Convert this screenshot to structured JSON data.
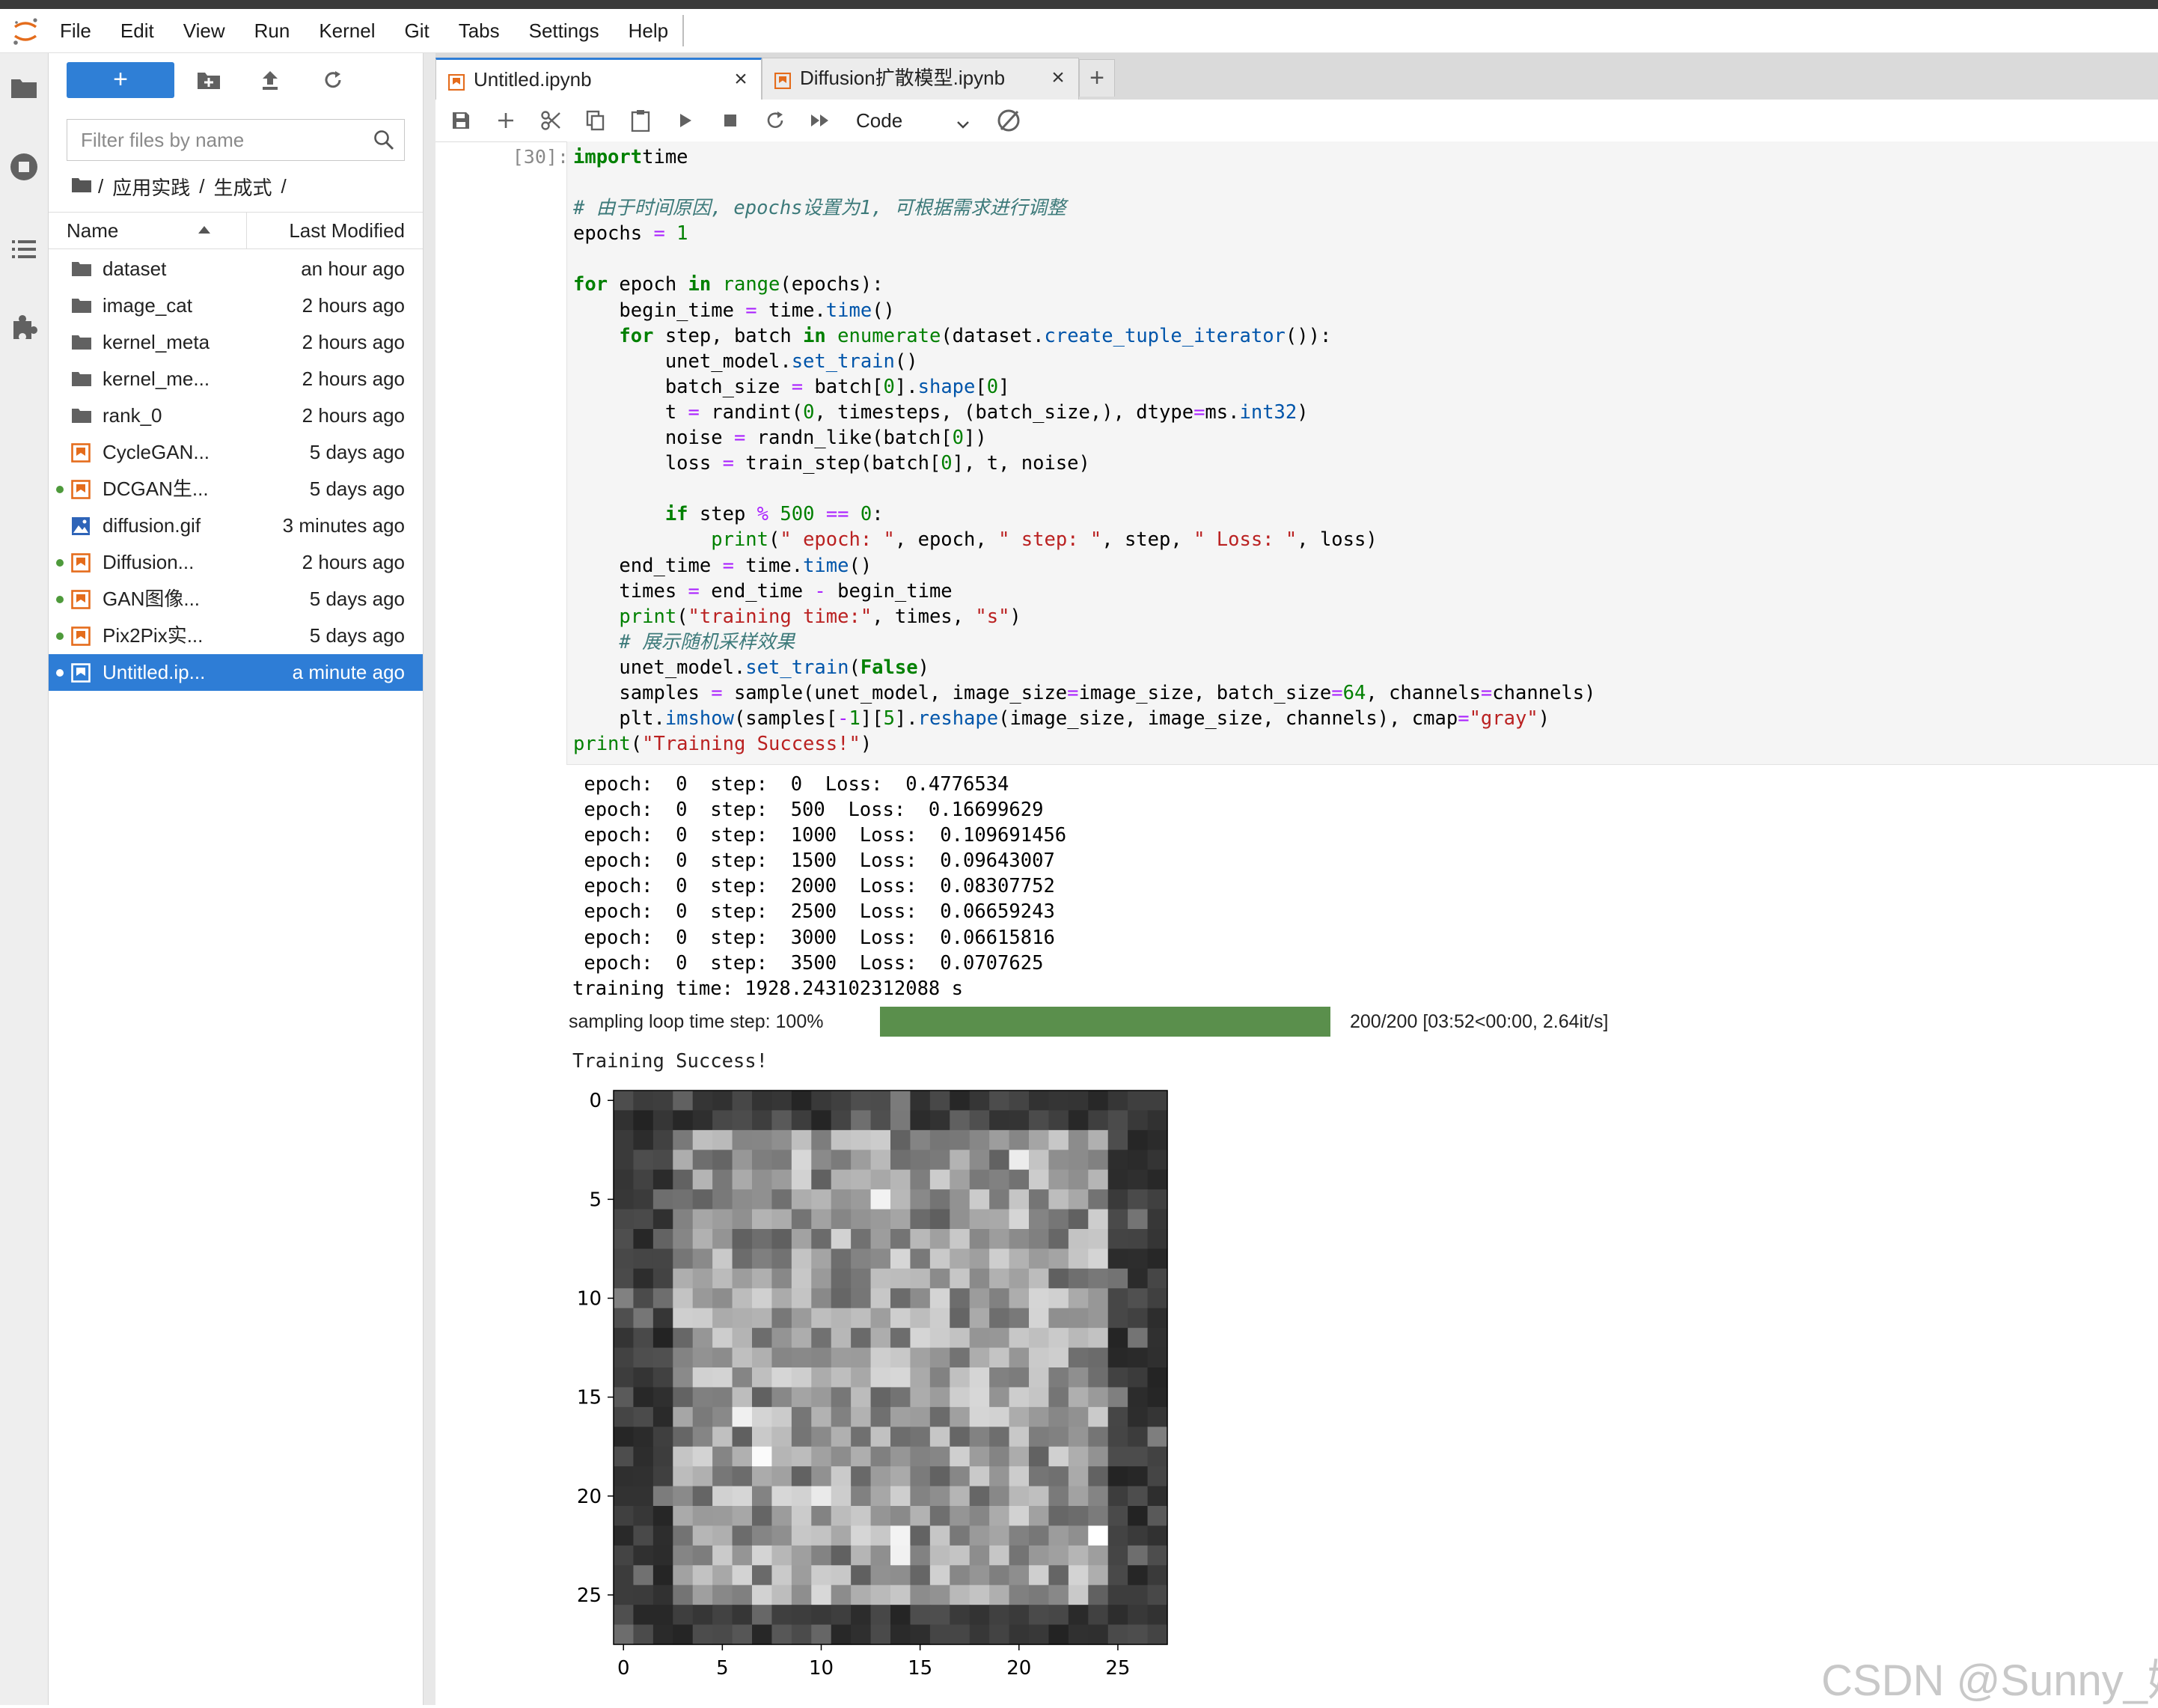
{
  "menubar": {
    "items": [
      "File",
      "Edit",
      "View",
      "Run",
      "Kernel",
      "Git",
      "Tabs",
      "Settings",
      "Help"
    ]
  },
  "filebrowser": {
    "new_label": "+",
    "filter_placeholder": "Filter files by name",
    "breadcrumb": [
      "/",
      "应用实践",
      "/",
      "生成式",
      "/"
    ],
    "columns": {
      "name": "Name",
      "modified": "Last Modified"
    },
    "files": [
      {
        "name": "dataset",
        "modified": "an hour ago",
        "type": "folder",
        "running": false,
        "selected": false
      },
      {
        "name": "image_cat",
        "modified": "2 hours ago",
        "type": "folder",
        "running": false,
        "selected": false
      },
      {
        "name": "kernel_meta",
        "modified": "2 hours ago",
        "type": "folder",
        "running": false,
        "selected": false
      },
      {
        "name": "kernel_me...",
        "modified": "2 hours ago",
        "type": "folder",
        "running": false,
        "selected": false
      },
      {
        "name": "rank_0",
        "modified": "2 hours ago",
        "type": "folder",
        "running": false,
        "selected": false
      },
      {
        "name": "CycleGAN...",
        "modified": "5 days ago",
        "type": "notebook",
        "running": false,
        "selected": false
      },
      {
        "name": "DCGAN生...",
        "modified": "5 days ago",
        "type": "notebook",
        "running": true,
        "selected": false
      },
      {
        "name": "diffusion.gif",
        "modified": "3 minutes ago",
        "type": "image",
        "running": false,
        "selected": false
      },
      {
        "name": "Diffusion...",
        "modified": "2 hours ago",
        "type": "notebook",
        "running": true,
        "selected": false
      },
      {
        "name": "GAN图像...",
        "modified": "5 days ago",
        "type": "notebook",
        "running": true,
        "selected": false
      },
      {
        "name": "Pix2Pix实...",
        "modified": "5 days ago",
        "type": "notebook",
        "running": true,
        "selected": false
      },
      {
        "name": "Untitled.ip...",
        "modified": "a minute ago",
        "type": "notebook",
        "running": true,
        "selected": true
      }
    ]
  },
  "tabs": [
    {
      "label": "Untitled.ipynb",
      "active": true
    },
    {
      "label": "Diffusion扩散模型.ipynb",
      "active": false
    }
  ],
  "tab_add": "+",
  "toolbar": {
    "cell_type": "Code"
  },
  "cell": {
    "prompt": "[30]:",
    "code": [
      [
        [
          "kw",
          "import"
        ],
        [
          "",
          "time"
        ]
      ],
      [],
      [
        [
          "cm",
          "# 由于时间原因, epochs设置为1, 可根据需求进行调整"
        ]
      ],
      [
        [
          "",
          "epochs "
        ],
        [
          "op",
          "="
        ],
        [
          "",
          ""
        ],
        [
          "num",
          " 1"
        ]
      ],
      [],
      [
        [
          "kw",
          "for"
        ],
        [
          "",
          " epoch "
        ],
        [
          "kw",
          "in"
        ],
        [
          "",
          " "
        ],
        [
          "bi",
          "range"
        ],
        [
          "",
          "(epochs):"
        ]
      ],
      [
        [
          "",
          "    begin_time "
        ],
        [
          "op",
          "="
        ],
        [
          "",
          " time."
        ],
        [
          "fn",
          "time"
        ],
        [
          "",
          "()"
        ]
      ],
      [
        [
          "",
          "    "
        ],
        [
          "kw",
          "for"
        ],
        [
          "",
          " step, batch "
        ],
        [
          "kw",
          "in"
        ],
        [
          "",
          " "
        ],
        [
          "bi",
          "enumerate"
        ],
        [
          "",
          "(dataset."
        ],
        [
          "fn",
          "create_tuple_iterator"
        ],
        [
          "",
          "()):"
        ]
      ],
      [
        [
          "",
          "        unet_model."
        ],
        [
          "fn",
          "set_train"
        ],
        [
          "",
          "()"
        ]
      ],
      [
        [
          "",
          "        batch_size "
        ],
        [
          "op",
          "="
        ],
        [
          "",
          " batch["
        ],
        [
          "num",
          "0"
        ],
        [
          "",
          "]."
        ],
        [
          "fn",
          "shape"
        ],
        [
          "",
          "["
        ],
        [
          "num",
          "0"
        ],
        [
          "",
          "]"
        ]
      ],
      [
        [
          "",
          "        t "
        ],
        [
          "op",
          "="
        ],
        [
          "",
          " randint("
        ],
        [
          "num",
          "0"
        ],
        [
          "",
          ", timesteps, (batch_size,), dtype"
        ],
        [
          "op",
          "="
        ],
        [
          "",
          "ms."
        ],
        [
          "fn",
          "int32"
        ],
        [
          "",
          ")"
        ]
      ],
      [
        [
          "",
          "        noise "
        ],
        [
          "op",
          "="
        ],
        [
          "",
          " randn_like(batch["
        ],
        [
          "num",
          "0"
        ],
        [
          "",
          "])"
        ]
      ],
      [
        [
          "",
          "        loss "
        ],
        [
          "op",
          "="
        ],
        [
          "",
          " train_step(batch["
        ],
        [
          "num",
          "0"
        ],
        [
          "",
          "], t, noise)"
        ]
      ],
      [],
      [
        [
          "",
          "        "
        ],
        [
          "kw",
          "if"
        ],
        [
          "",
          " step "
        ],
        [
          "op",
          "%"
        ],
        [
          "num",
          " 500"
        ],
        [
          "",
          " "
        ],
        [
          "op",
          "=="
        ],
        [
          "num",
          " 0"
        ],
        [
          "",
          ":"
        ]
      ],
      [
        [
          "",
          "            "
        ],
        [
          "bi",
          "print"
        ],
        [
          "",
          "("
        ],
        [
          "str",
          "\" epoch: \""
        ],
        [
          "",
          ", epoch, "
        ],
        [
          "str",
          "\" step: \""
        ],
        [
          "",
          ", step, "
        ],
        [
          "str",
          "\" Loss: \""
        ],
        [
          "",
          ", loss)"
        ]
      ],
      [
        [
          "",
          "    end_time "
        ],
        [
          "op",
          "="
        ],
        [
          "",
          " time."
        ],
        [
          "fn",
          "time"
        ],
        [
          "",
          "()"
        ]
      ],
      [
        [
          "",
          "    times "
        ],
        [
          "op",
          "="
        ],
        [
          "",
          " end_time "
        ],
        [
          "op",
          "-"
        ],
        [
          "",
          " begin_time"
        ]
      ],
      [
        [
          "",
          "    "
        ],
        [
          "bi",
          "print"
        ],
        [
          "",
          "("
        ],
        [
          "str",
          "\"training time:\""
        ],
        [
          "",
          ", times, "
        ],
        [
          "str",
          "\"s\""
        ],
        [
          "",
          ")"
        ]
      ],
      [
        [
          "",
          "    "
        ],
        [
          "cm",
          "# 展示随机采样效果"
        ]
      ],
      [
        [
          "",
          "    unet_model."
        ],
        [
          "fn",
          "set_train"
        ],
        [
          "",
          "("
        ],
        [
          "kw",
          "False"
        ],
        [
          "",
          ")"
        ]
      ],
      [
        [
          "",
          "    samples "
        ],
        [
          "op",
          "="
        ],
        [
          "",
          " sample(unet_model, image_size"
        ],
        [
          "op",
          "="
        ],
        [
          "",
          "image_size, batch_size"
        ],
        [
          "op",
          "="
        ],
        [
          "num",
          "64"
        ],
        [
          "",
          ", channels"
        ],
        [
          "op",
          "="
        ],
        [
          "",
          "channels)"
        ]
      ],
      [
        [
          "",
          "    plt."
        ],
        [
          "fn",
          "imshow"
        ],
        [
          "",
          "(samples["
        ],
        [
          "op",
          "-"
        ],
        [
          "num",
          "1"
        ],
        [
          "",
          "]["
        ],
        [
          "num",
          "5"
        ],
        [
          "",
          "]."
        ],
        [
          "fn",
          "reshape"
        ],
        [
          "",
          "(image_size, image_size, channels), cmap"
        ],
        [
          "op",
          "="
        ],
        [
          "str",
          "\"gray\""
        ],
        [
          "",
          ")"
        ]
      ],
      [
        [
          "bi",
          "print"
        ],
        [
          "",
          "("
        ],
        [
          "str",
          "\"Training Success!\""
        ],
        [
          "",
          ")"
        ]
      ]
    ]
  },
  "output": {
    "log_lines": [
      " epoch:  0  step:  0  Loss:  0.4776534",
      " epoch:  0  step:  500  Loss:  0.16699629",
      " epoch:  0  step:  1000  Loss:  0.109691456",
      " epoch:  0  step:  1500  Loss:  0.09643007",
      " epoch:  0  step:  2000  Loss:  0.08307752",
      " epoch:  0  step:  2500  Loss:  0.06659243",
      " epoch:  0  step:  3000  Loss:  0.06615816",
      " epoch:  0  step:  3500  Loss:  0.0707625",
      "training time: 1928.243102312088 s"
    ],
    "progress": {
      "label": "sampling  loop  time  step:  100%",
      "fraction": 1.0,
      "info": "200/200  [03:52<00:00,    2.64it/s]"
    },
    "final_line": "Training Success!"
  },
  "chart_data": {
    "type": "heatmap",
    "cmap": "gray",
    "rows": 28,
    "cols": 28,
    "xlim": [
      0,
      27
    ],
    "ylim": [
      27,
      0
    ],
    "xticks": [
      0,
      5,
      10,
      15,
      20,
      25
    ],
    "yticks": [
      0,
      5,
      10,
      15,
      20,
      25
    ],
    "title": "",
    "xlabel": "",
    "ylabel": ""
  },
  "watermark": "CSDN @Sunny_媛",
  "colors": {
    "accent": "#2e7dd6",
    "progress": "#5a8f4c",
    "notebook_icon": "#e46c1c",
    "running_dot": "#4e9a3b"
  }
}
